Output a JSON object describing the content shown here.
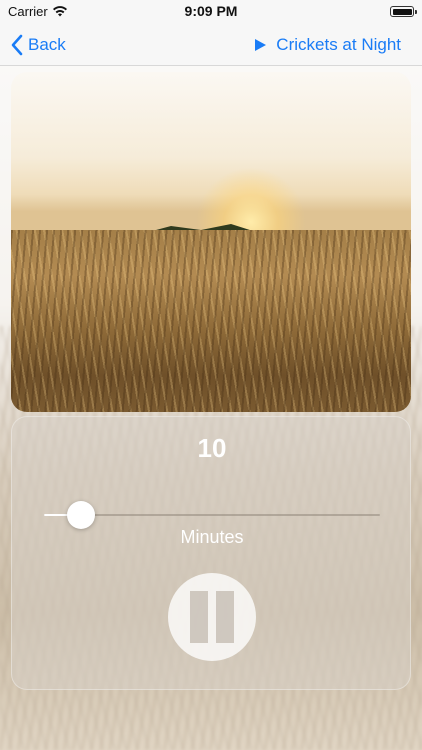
{
  "status_bar": {
    "carrier": "Carrier",
    "time": "9:09 PM"
  },
  "nav": {
    "back_label": "Back",
    "track_label": "Crickets at Night",
    "accent_color": "#1a7cf6"
  },
  "timer": {
    "value": "10",
    "unit": "Minutes",
    "slider_fraction": 0.11
  },
  "icons": {
    "back": "chevron-left-icon",
    "play": "play-icon",
    "pause": "pause-icon",
    "wifi": "wifi-icon",
    "battery": "battery-icon"
  }
}
